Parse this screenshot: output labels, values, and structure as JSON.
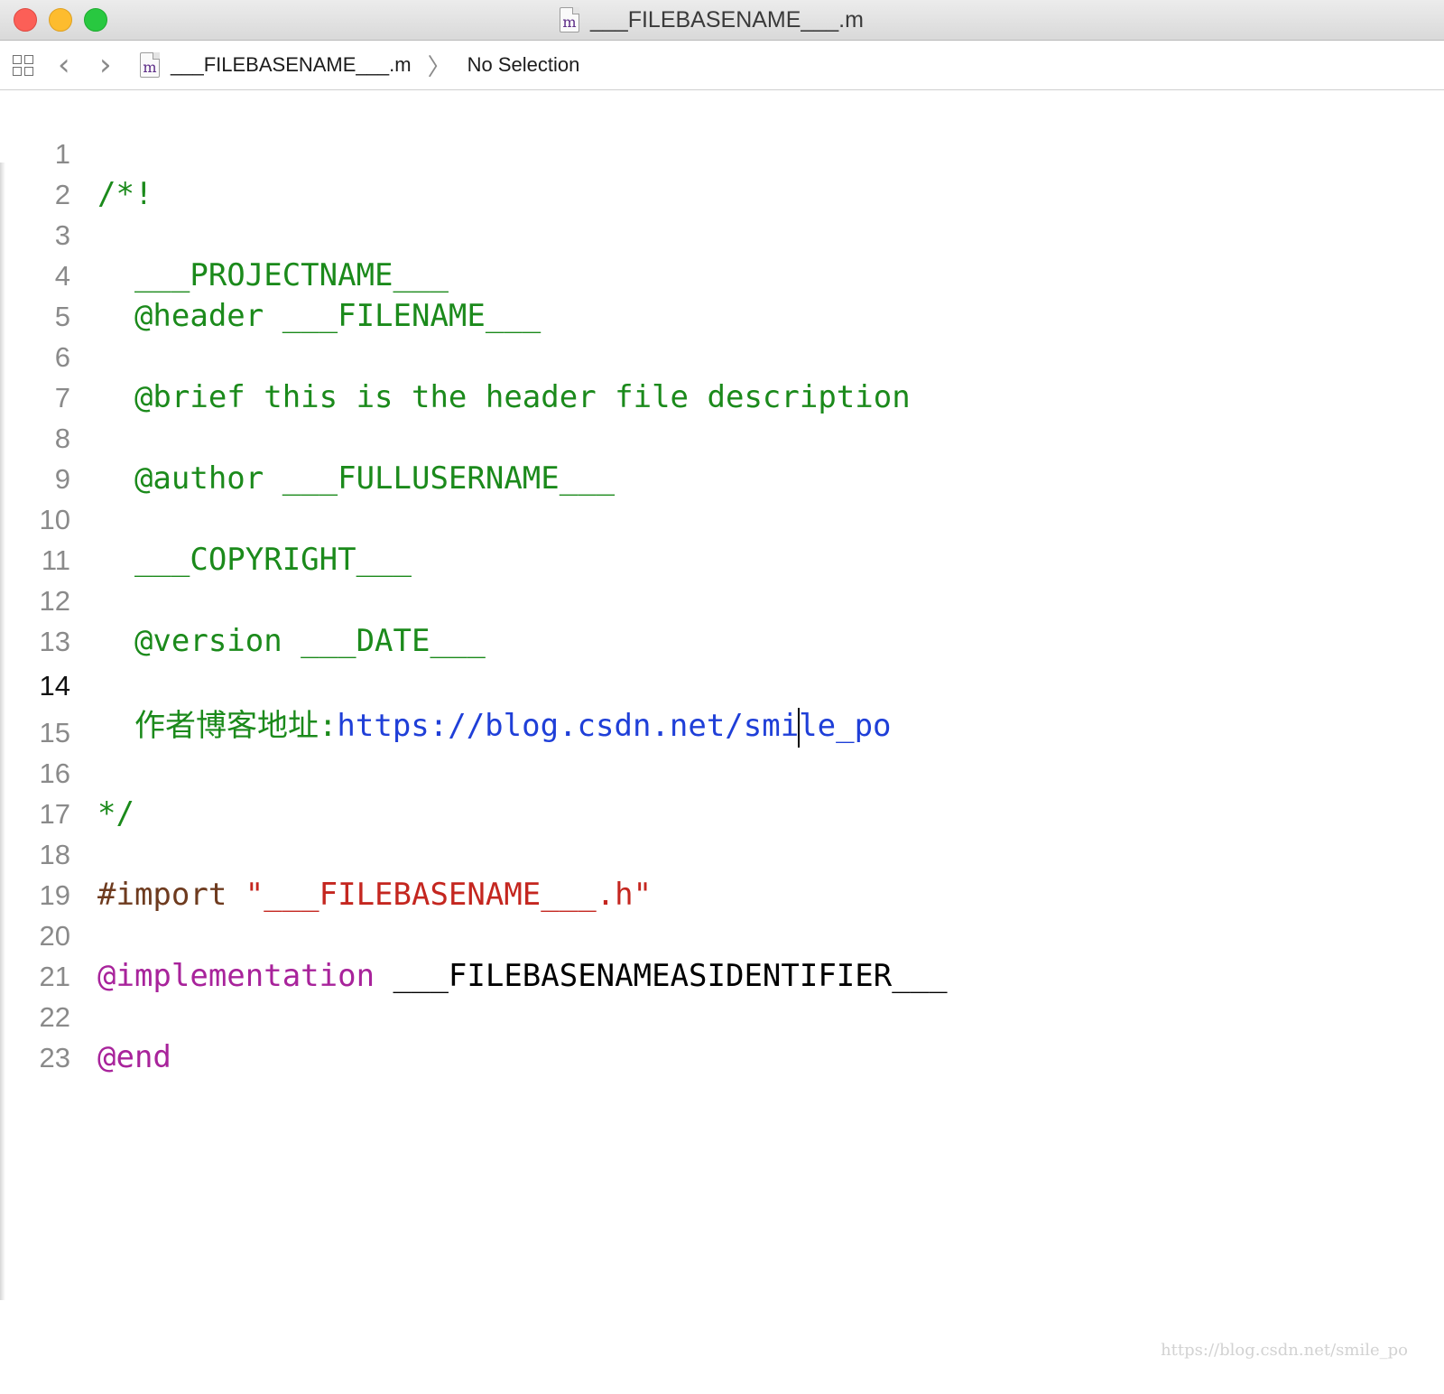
{
  "window": {
    "title": "___FILEBASENAME___.m",
    "file_icon_glyph": "m"
  },
  "jumpbar": {
    "file_name": "___FILEBASENAME___.m",
    "separator": "〉",
    "selection": "No Selection"
  },
  "editor": {
    "current_line": 14,
    "line_numbers": [
      "1",
      "2",
      "3",
      "4",
      "5",
      "6",
      "7",
      "8",
      "9",
      "10",
      "11",
      "12",
      "13",
      "14",
      "15",
      "16",
      "17",
      "18",
      "19",
      "20",
      "21",
      "22",
      "23"
    ],
    "lines": {
      "l1": "/*!",
      "l3": "  ___PROJECTNAME___",
      "l4": "  @header ___FILENAME___",
      "l6": "  @brief this is the header file description",
      "l8": "  @author ___FULLUSERNAME___",
      "l10": "  ___COPYRIGHT___",
      "l12": "  @version ___DATE___",
      "l14_prefix": "  作者博客地址:",
      "l14_url_a": "https://blog.csdn.net/smi",
      "l14_url_b": "le_po",
      "l16": "*/",
      "l18_directive": "#import ",
      "l18_string": "\"___FILEBASENAME___.h\"",
      "l20_keyword": "@implementation",
      "l20_identifier": " ___FILEBASENAMEASIDENTIFIER___",
      "l22": "@end"
    }
  },
  "watermark": "https://blog.csdn.net/smile_po",
  "colors": {
    "comment": "#1b8a1b",
    "url": "#1f3fd8",
    "preprocessor": "#6e3b1f",
    "string": "#c4261f",
    "keyword": "#a8239b"
  }
}
